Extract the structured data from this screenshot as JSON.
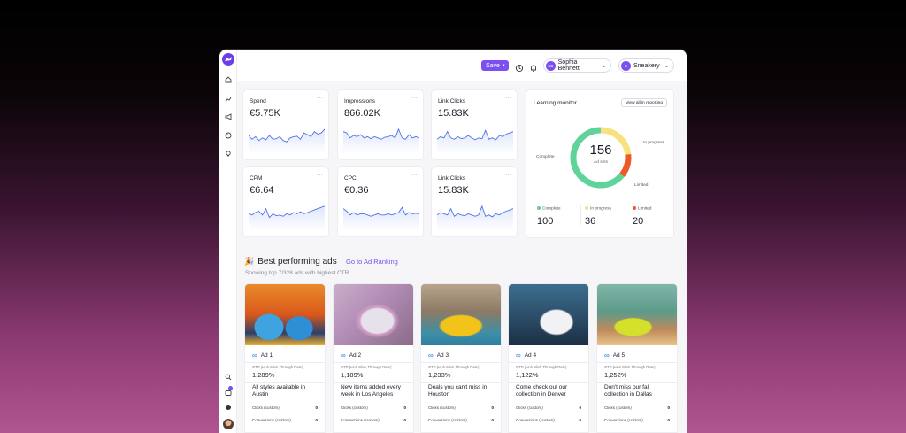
{
  "topbar": {
    "save_label": "Save",
    "user_initials": "SB",
    "user_name": "Sophia Bennett",
    "brand_initial": "S",
    "brand_name": "Sneakery"
  },
  "metrics": [
    {
      "label": "Spend",
      "value": "€5.75K",
      "more": "···"
    },
    {
      "label": "Impressions",
      "value": "866.02K",
      "more": "···"
    },
    {
      "label": "Link Clicks",
      "value": "15.83K",
      "more": "···"
    },
    {
      "label": "CPM",
      "value": "€6.64",
      "more": "···"
    },
    {
      "label": "CPC",
      "value": "€0.36",
      "more": "···"
    },
    {
      "label": "Link Clicks",
      "value": "15.83K",
      "more": "···"
    }
  ],
  "learning_monitor": {
    "title": "Learning monitor",
    "view_all": "View all in reporting",
    "total": "156",
    "total_label": "Ad sets",
    "callouts": {
      "complete": "Complete",
      "in_progress": "In progress",
      "limited": "Limited"
    },
    "segments": [
      {
        "label": "Complete",
        "value": "100",
        "color": "#5fd39a"
      },
      {
        "label": "In progress",
        "value": "36",
        "color": "#f6e27e"
      },
      {
        "label": "Limited",
        "value": "20",
        "color": "#ec5a2a"
      }
    ]
  },
  "best_ads": {
    "emoji": "🎉",
    "title": "Best performing ads",
    "link": "Go to Ad Ranking",
    "subtitle": "Showing top 7/328 ads with highest CTR",
    "ads": [
      {
        "name": "Ad 1",
        "ctr_label": "CTR (Link Click-Through Rate)",
        "ctr": "1,289%",
        "copy": "All styles available in Austin",
        "clicks_label": "Clicks (custom)",
        "clicks": "0",
        "conv_label": "Conversions (custom)",
        "conv": "0"
      },
      {
        "name": "Ad 2",
        "ctr_label": "CTR (Link Click-Through Rate)",
        "ctr": "1,189%",
        "copy": "New items added every week in Los Angeles",
        "clicks_label": "Clicks (custom)",
        "clicks": "0",
        "conv_label": "Conversions (custom)",
        "conv": "0"
      },
      {
        "name": "Ad 3",
        "ctr_label": "CTR (Link Click-Through Rate)",
        "ctr": "1,233%",
        "copy": "Deals you can't miss in Houston",
        "clicks_label": "Clicks (custom)",
        "clicks": "0",
        "conv_label": "Conversions (custom)",
        "conv": "0"
      },
      {
        "name": "Ad 4",
        "ctr_label": "CTR (Link Click-Through Rate)",
        "ctr": "1,122%",
        "copy": "Come check out our collection in Denver",
        "clicks_label": "Clicks (custom)",
        "clicks": "0",
        "conv_label": "Conversions (custom)",
        "conv": "0"
      },
      {
        "name": "Ad 5",
        "ctr_label": "CTR (Link Click-Through Rate)",
        "ctr": "1,252%",
        "copy": "Don't miss our fall collection in Dallas",
        "clicks_label": "Clicks (custom)",
        "clicks": "0",
        "conv_label": "Conversions (custom)",
        "conv": "0"
      }
    ]
  },
  "colors": {
    "accent": "#7b4ff0",
    "sparkline": "#4f74e8",
    "meta_blue": "#1877f2"
  }
}
